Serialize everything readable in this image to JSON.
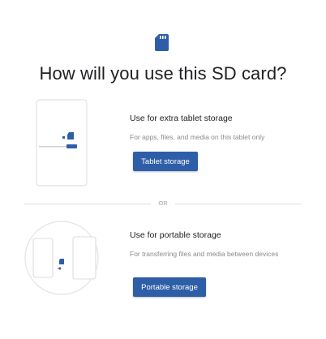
{
  "dialog": {
    "title": "How will you use this SD card?"
  },
  "options": [
    {
      "title": "Use for extra tablet storage",
      "description": "For apps, files, and media on this tablet only",
      "button_label": "Tablet storage"
    },
    {
      "title": "Use for portable storage",
      "description": "For transferring files and media between devices",
      "button_label": "Portable storage"
    }
  ],
  "divider": {
    "label": "OR"
  },
  "colors": {
    "accent": "#2f5ea8",
    "icon": "#2f5ea8",
    "title_text": "#202124",
    "secondary_text": "#8a8a8a",
    "divider": "#dcdcdc"
  },
  "icons": {
    "top": "sd-card-icon",
    "tablet": "tablet-storage-illustration",
    "portable": "portable-storage-illustration"
  }
}
